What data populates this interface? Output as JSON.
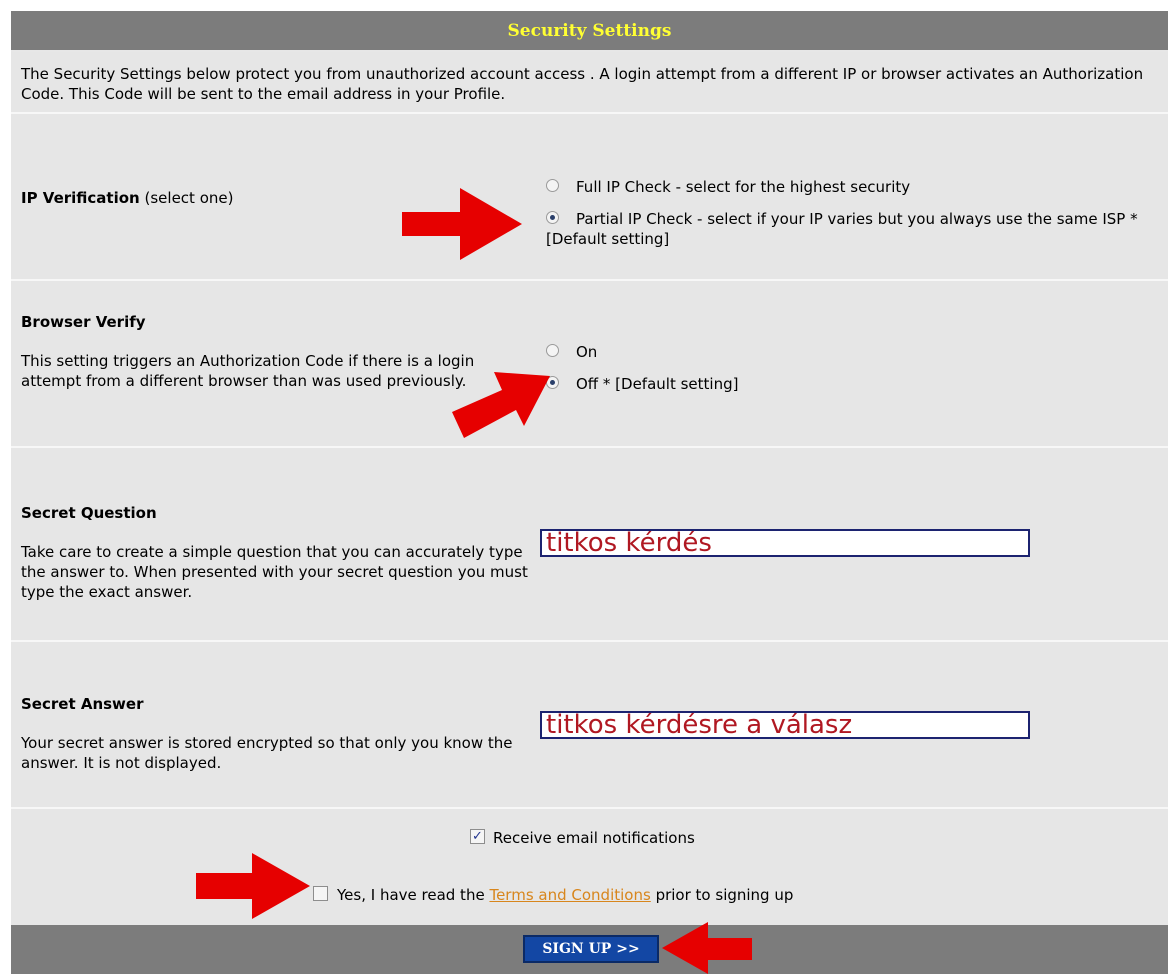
{
  "header": {
    "title": "Security Settings"
  },
  "intro": {
    "text": "The Security Settings below protect you from unauthorized account access . A login attempt from a different IP or browser activates an Authorization Code. This Code will be sent to the email address in your Profile."
  },
  "ip_verification": {
    "label": "IP Verification",
    "hint": "(select one)",
    "options": [
      {
        "label": "Full IP Check - select for the highest security",
        "checked": false
      },
      {
        "label": "Partial IP Check - select if your IP varies but you always use the same ISP * [Default setting]",
        "checked": true
      }
    ]
  },
  "browser_verify": {
    "label": "Browser Verify",
    "description": "This setting triggers an Authorization Code if there is a login attempt from a different browser than was used previously.",
    "options": [
      {
        "label": "On",
        "checked": false
      },
      {
        "label": "Off * [Default setting]",
        "checked": true
      }
    ]
  },
  "secret_question": {
    "label": "Secret Question",
    "description": "Take care to create a simple question that you can accurately type the answer to. When presented with your secret question you must type the exact answer.",
    "value": "titkos kérdés"
  },
  "secret_answer": {
    "label": "Secret Answer",
    "description": "Your secret answer is stored encrypted so that only you know the answer. It is not displayed.",
    "value": "titkos kérdésre a válasz"
  },
  "notifications": {
    "label": "Receive email notifications",
    "checked": true
  },
  "terms": {
    "prefix": "Yes, I have read the",
    "link_text": "Terms and Conditions",
    "suffix": "prior to signing up",
    "checked": false
  },
  "footer": {
    "button_label": "SIGN UP >>"
  },
  "colors": {
    "header_bg": "#7c7c7c",
    "header_text": "#ffff33",
    "panel_bg": "#e6e6e6",
    "arrow": "#e60000",
    "button_bg": "#1347a4",
    "link": "#d8861d"
  }
}
